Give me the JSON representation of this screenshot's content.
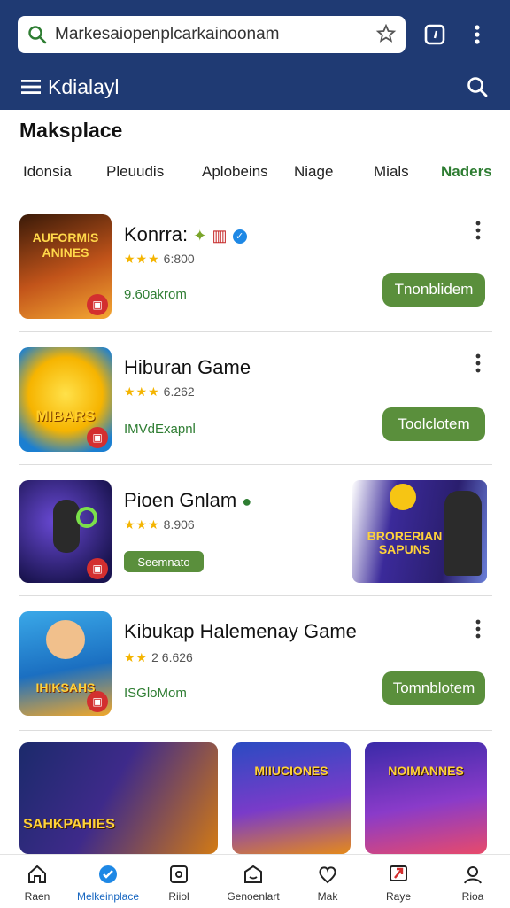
{
  "search": {
    "value": "Markesaiopenplcarkainoonam"
  },
  "header": {
    "title": "Kdialayl"
  },
  "page": {
    "title": "Maksplace"
  },
  "tabs": [
    {
      "label": "Idonsia"
    },
    {
      "label": "Pleuudis"
    },
    {
      "label": "Aplobeins"
    },
    {
      "label": "Niage"
    },
    {
      "label": "Mials"
    },
    {
      "label": "Naders",
      "active": true
    }
  ],
  "apps": [
    {
      "title": "Konrra:",
      "rating": "6:800",
      "stars": "★★★",
      "sub": "9.60akrom",
      "button": "Tnonblidem",
      "thumb_text": "AUFORMIS ANINES"
    },
    {
      "title": "Hiburan Game",
      "rating": "6.262",
      "stars": "★★★",
      "sub": "IMVdExapnl",
      "button": "Toolclotem",
      "thumb_text": "MIBARS"
    },
    {
      "title": "Pioen Gnlam",
      "rating": "8.906",
      "stars": "★★★",
      "sub": "",
      "button": "Seemnato",
      "thumb_text": "",
      "promo_text": "BRORERIAN SAPUNS"
    },
    {
      "title": "Kibukap Halemenay Game",
      "rating": "2 6.626",
      "stars": "★★",
      "sub": "ISGloMom",
      "button": "Tomnblotem",
      "thumb_text": "IHIKSAHS"
    }
  ],
  "tiles": [
    {
      "text": "SAHKPAHIES"
    },
    {
      "text": "MIIUCIONES"
    },
    {
      "text": "NOIMANNES"
    }
  ],
  "nav": [
    {
      "label": "Raen",
      "icon": "home-icon"
    },
    {
      "label": "Melkeinplace",
      "icon": "marketplace-icon",
      "active": true
    },
    {
      "label": "Riiol",
      "icon": "square-icon"
    },
    {
      "label": "Genoenlart",
      "icon": "store-icon"
    },
    {
      "label": "Mak",
      "icon": "heart-icon"
    },
    {
      "label": "Raye",
      "icon": "flag-icon"
    },
    {
      "label": "Rioa",
      "icon": "profile-icon"
    }
  ],
  "colors": {
    "header": "#1f3a73",
    "accent": "#5a8f3c",
    "active_tab": "#2e7d32",
    "stars": "#f4b400"
  }
}
